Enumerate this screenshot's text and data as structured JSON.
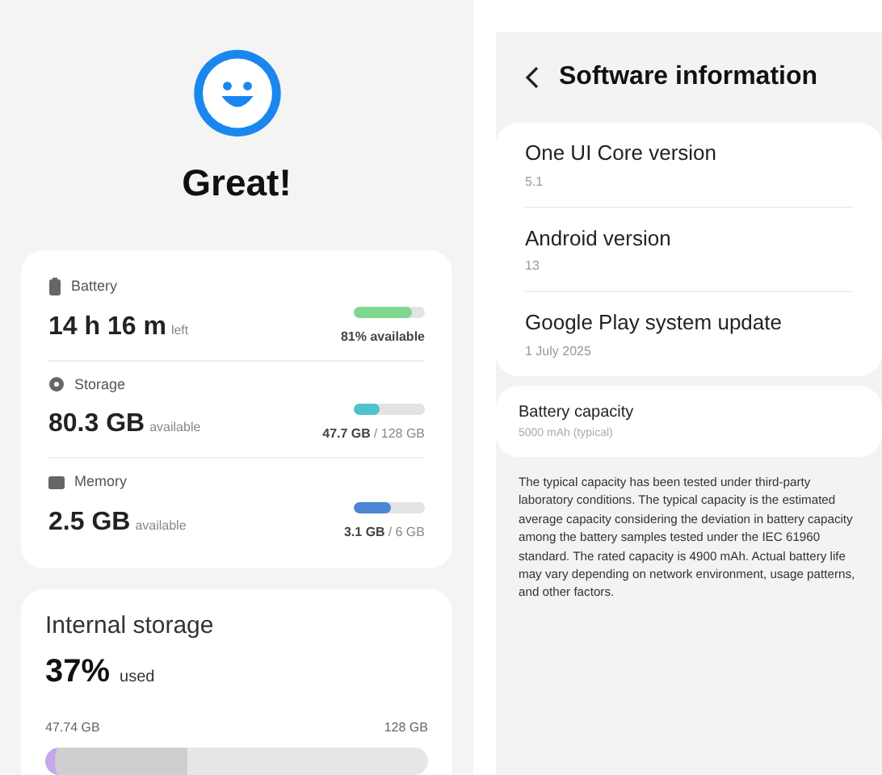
{
  "status": {
    "title": "Great!"
  },
  "resources": [
    {
      "kind": "battery",
      "label": "Battery",
      "value": "14 h 16 m",
      "unit": "left",
      "level": 0.81,
      "reading": "81% available",
      "color": "#7fd68e"
    },
    {
      "kind": "storage",
      "label": "Storage",
      "value": "80.3 GB",
      "unit": "available",
      "level": 0.37,
      "reading_used": "47.7 GB",
      "reading_total": "/ 128 GB",
      "color": "#4fc3c9"
    },
    {
      "kind": "memory",
      "label": "Memory",
      "value": "2.5 GB",
      "unit": "available",
      "level": 0.52,
      "reading_used": "3.1 GB",
      "reading_total": "/ 6 GB",
      "color": "#4a86d4"
    }
  ],
  "internal_storage": {
    "title": "Internal storage",
    "percent": "37%",
    "unit": "used",
    "used": "47.74 GB",
    "total": "128 GB",
    "level": 0.37
  },
  "software": {
    "title": "Software information",
    "items": [
      {
        "label": "One UI Core version",
        "value": "5.1"
      },
      {
        "label": "Android version",
        "value": "13"
      },
      {
        "label": "Google Play system update",
        "value": "1 July 2025"
      }
    ],
    "battery": {
      "label": "Battery capacity",
      "value": "5000 mAh (typical)"
    },
    "note": "The typical capacity has been tested under third-party laboratory conditions. The typical capacity is the estimated average capacity considering the deviation in battery capacity among the battery samples tested under the IEC 61960 standard. The rated capacity is 4900 mAh. Actual battery life may vary depending on network environment, usage patterns, and other factors."
  }
}
